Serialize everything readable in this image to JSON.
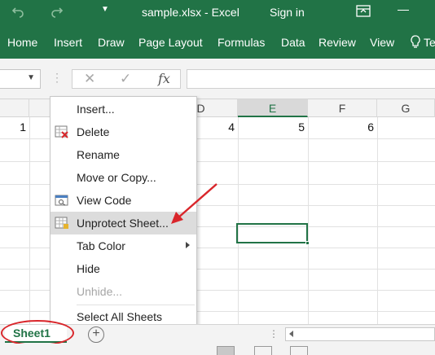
{
  "titlebar": {
    "undo_icon": "undo-icon",
    "redo_icon": "redo-icon",
    "qat_icon": "customize-qat-icon",
    "title": "sample.xlsx  -  Excel",
    "signin": "Sign in",
    "ribbon_display_icon": "ribbon-display-options-icon",
    "minimize_icon": "minimize-icon"
  },
  "ribbon": {
    "tabs": [
      "Home",
      "Insert",
      "Draw",
      "Page Layout",
      "Formulas",
      "Data",
      "Review",
      "View"
    ],
    "tell_me": "Te"
  },
  "formula_bar": {
    "cancel_icon": "cancel-icon",
    "enter_icon": "enter-icon",
    "fx": "fx",
    "value": ""
  },
  "grid": {
    "columns": [
      "D",
      "E",
      "F",
      "G"
    ],
    "selected_column": "E",
    "row1_values": [
      "1",
      "4",
      "5",
      "6"
    ]
  },
  "context_menu": {
    "items": [
      {
        "label": "Insert...",
        "icon": ""
      },
      {
        "label": "Delete",
        "icon": "delete-sheet-icon"
      },
      {
        "label": "Rename",
        "icon": ""
      },
      {
        "label": "Move or Copy...",
        "icon": ""
      },
      {
        "label": "View Code",
        "icon": "view-code-icon"
      },
      {
        "label": "Unprotect Sheet...",
        "icon": "unprotect-sheet-icon",
        "highlighted": true
      },
      {
        "label": "Tab Color",
        "icon": "",
        "submenu": true
      },
      {
        "label": "Hide",
        "icon": ""
      },
      {
        "label": "Unhide...",
        "icon": "",
        "disabled": true
      },
      {
        "label": "Select All Sheets",
        "icon": ""
      }
    ]
  },
  "sheets": {
    "tabs": [
      "Sheet1"
    ],
    "add_icon": "add-sheet-icon"
  },
  "colors": {
    "excel_green": "#217346",
    "highlight_red": "#d9262b"
  }
}
